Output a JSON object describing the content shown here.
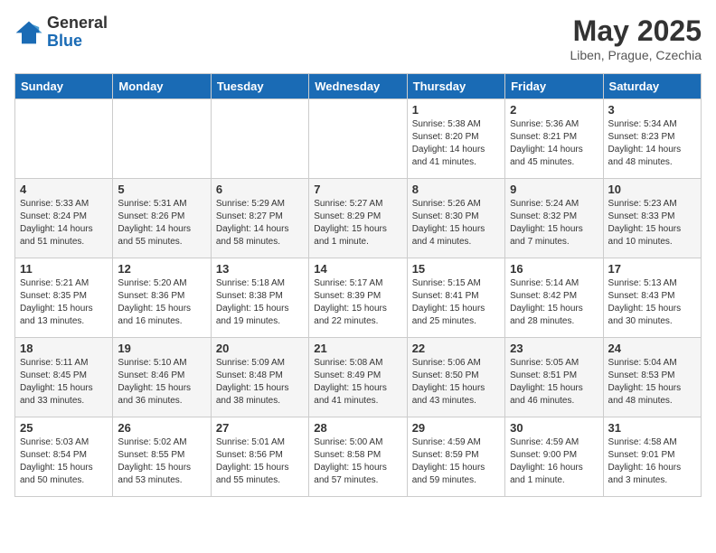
{
  "logo": {
    "general": "General",
    "blue": "Blue"
  },
  "header": {
    "month": "May 2025",
    "location": "Liben, Prague, Czechia"
  },
  "weekdays": [
    "Sunday",
    "Monday",
    "Tuesday",
    "Wednesday",
    "Thursday",
    "Friday",
    "Saturday"
  ],
  "weeks": [
    [
      {
        "day": "",
        "info": ""
      },
      {
        "day": "",
        "info": ""
      },
      {
        "day": "",
        "info": ""
      },
      {
        "day": "",
        "info": ""
      },
      {
        "day": "1",
        "info": "Sunrise: 5:38 AM\nSunset: 8:20 PM\nDaylight: 14 hours\nand 41 minutes."
      },
      {
        "day": "2",
        "info": "Sunrise: 5:36 AM\nSunset: 8:21 PM\nDaylight: 14 hours\nand 45 minutes."
      },
      {
        "day": "3",
        "info": "Sunrise: 5:34 AM\nSunset: 8:23 PM\nDaylight: 14 hours\nand 48 minutes."
      }
    ],
    [
      {
        "day": "4",
        "info": "Sunrise: 5:33 AM\nSunset: 8:24 PM\nDaylight: 14 hours\nand 51 minutes."
      },
      {
        "day": "5",
        "info": "Sunrise: 5:31 AM\nSunset: 8:26 PM\nDaylight: 14 hours\nand 55 minutes."
      },
      {
        "day": "6",
        "info": "Sunrise: 5:29 AM\nSunset: 8:27 PM\nDaylight: 14 hours\nand 58 minutes."
      },
      {
        "day": "7",
        "info": "Sunrise: 5:27 AM\nSunset: 8:29 PM\nDaylight: 15 hours\nand 1 minute."
      },
      {
        "day": "8",
        "info": "Sunrise: 5:26 AM\nSunset: 8:30 PM\nDaylight: 15 hours\nand 4 minutes."
      },
      {
        "day": "9",
        "info": "Sunrise: 5:24 AM\nSunset: 8:32 PM\nDaylight: 15 hours\nand 7 minutes."
      },
      {
        "day": "10",
        "info": "Sunrise: 5:23 AM\nSunset: 8:33 PM\nDaylight: 15 hours\nand 10 minutes."
      }
    ],
    [
      {
        "day": "11",
        "info": "Sunrise: 5:21 AM\nSunset: 8:35 PM\nDaylight: 15 hours\nand 13 minutes."
      },
      {
        "day": "12",
        "info": "Sunrise: 5:20 AM\nSunset: 8:36 PM\nDaylight: 15 hours\nand 16 minutes."
      },
      {
        "day": "13",
        "info": "Sunrise: 5:18 AM\nSunset: 8:38 PM\nDaylight: 15 hours\nand 19 minutes."
      },
      {
        "day": "14",
        "info": "Sunrise: 5:17 AM\nSunset: 8:39 PM\nDaylight: 15 hours\nand 22 minutes."
      },
      {
        "day": "15",
        "info": "Sunrise: 5:15 AM\nSunset: 8:41 PM\nDaylight: 15 hours\nand 25 minutes."
      },
      {
        "day": "16",
        "info": "Sunrise: 5:14 AM\nSunset: 8:42 PM\nDaylight: 15 hours\nand 28 minutes."
      },
      {
        "day": "17",
        "info": "Sunrise: 5:13 AM\nSunset: 8:43 PM\nDaylight: 15 hours\nand 30 minutes."
      }
    ],
    [
      {
        "day": "18",
        "info": "Sunrise: 5:11 AM\nSunset: 8:45 PM\nDaylight: 15 hours\nand 33 minutes."
      },
      {
        "day": "19",
        "info": "Sunrise: 5:10 AM\nSunset: 8:46 PM\nDaylight: 15 hours\nand 36 minutes."
      },
      {
        "day": "20",
        "info": "Sunrise: 5:09 AM\nSunset: 8:48 PM\nDaylight: 15 hours\nand 38 minutes."
      },
      {
        "day": "21",
        "info": "Sunrise: 5:08 AM\nSunset: 8:49 PM\nDaylight: 15 hours\nand 41 minutes."
      },
      {
        "day": "22",
        "info": "Sunrise: 5:06 AM\nSunset: 8:50 PM\nDaylight: 15 hours\nand 43 minutes."
      },
      {
        "day": "23",
        "info": "Sunrise: 5:05 AM\nSunset: 8:51 PM\nDaylight: 15 hours\nand 46 minutes."
      },
      {
        "day": "24",
        "info": "Sunrise: 5:04 AM\nSunset: 8:53 PM\nDaylight: 15 hours\nand 48 minutes."
      }
    ],
    [
      {
        "day": "25",
        "info": "Sunrise: 5:03 AM\nSunset: 8:54 PM\nDaylight: 15 hours\nand 50 minutes."
      },
      {
        "day": "26",
        "info": "Sunrise: 5:02 AM\nSunset: 8:55 PM\nDaylight: 15 hours\nand 53 minutes."
      },
      {
        "day": "27",
        "info": "Sunrise: 5:01 AM\nSunset: 8:56 PM\nDaylight: 15 hours\nand 55 minutes."
      },
      {
        "day": "28",
        "info": "Sunrise: 5:00 AM\nSunset: 8:58 PM\nDaylight: 15 hours\nand 57 minutes."
      },
      {
        "day": "29",
        "info": "Sunrise: 4:59 AM\nSunset: 8:59 PM\nDaylight: 15 hours\nand 59 minutes."
      },
      {
        "day": "30",
        "info": "Sunrise: 4:59 AM\nSunset: 9:00 PM\nDaylight: 16 hours\nand 1 minute."
      },
      {
        "day": "31",
        "info": "Sunrise: 4:58 AM\nSunset: 9:01 PM\nDaylight: 16 hours\nand 3 minutes."
      }
    ]
  ]
}
